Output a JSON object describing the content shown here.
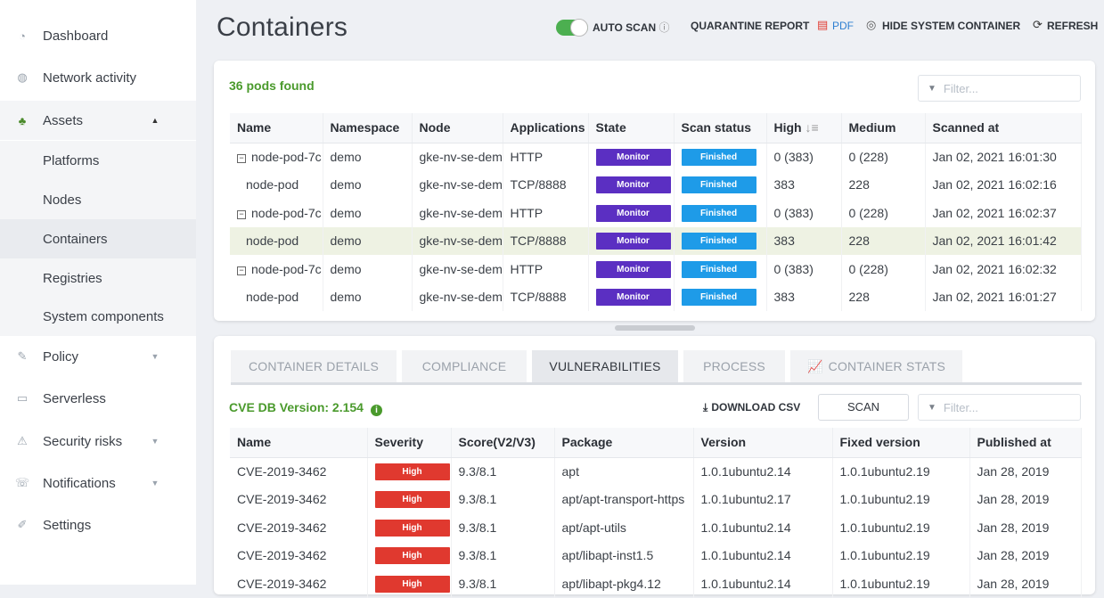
{
  "sidebar": {
    "items": [
      {
        "label": "Dashboard",
        "icon": "dashboard-icon"
      },
      {
        "label": "Network activity",
        "icon": "globe-icon"
      },
      {
        "label": "Assets",
        "icon": "assets-icon"
      },
      {
        "label": "Platforms"
      },
      {
        "label": "Nodes"
      },
      {
        "label": "Containers"
      },
      {
        "label": "Registries"
      },
      {
        "label": "System components"
      },
      {
        "label": "Policy",
        "icon": "policy-icon"
      },
      {
        "label": "Serverless",
        "icon": "serverless-icon"
      },
      {
        "label": "Security risks",
        "icon": "security-risks-icon"
      },
      {
        "label": "Notifications",
        "icon": "notifications-icon"
      },
      {
        "label": "Settings",
        "icon": "settings-icon"
      }
    ]
  },
  "header": {
    "title": "Containers",
    "auto_scan": "AUTO SCAN",
    "quarantine_report": "QUARANTINE REPORT",
    "pdf": "PDF",
    "hide_system": "HIDE SYSTEM CONTAINER",
    "refresh": "REFRESH"
  },
  "pods": {
    "count_text": "36 pods found",
    "filter_placeholder": "Filter...",
    "columns": [
      "Name",
      "Namespace",
      "Node",
      "Applications",
      "State",
      "Scan status",
      "High",
      "Medium",
      "Scanned at"
    ],
    "rows": [
      {
        "name": "node-pod-7c",
        "ns": "demo",
        "node": "gke-nv-se-dem",
        "app": "HTTP",
        "state": "Monitor",
        "scan": "Finished",
        "high": "0 (383)",
        "medium": "0 (228)",
        "at": "Jan 02, 2021 16:01:30",
        "expand": true
      },
      {
        "name": "node-pod",
        "ns": "demo",
        "node": "gke-nv-se-dem",
        "app": "TCP/8888",
        "state": "Monitor",
        "scan": "Finished",
        "high": "383",
        "medium": "228",
        "at": "Jan 02, 2021 16:02:16",
        "expand": false
      },
      {
        "name": "node-pod-7c",
        "ns": "demo",
        "node": "gke-nv-se-dem",
        "app": "HTTP",
        "state": "Monitor",
        "scan": "Finished",
        "high": "0 (383)",
        "medium": "0 (228)",
        "at": "Jan 02, 2021 16:02:37",
        "expand": true
      },
      {
        "name": "node-pod",
        "ns": "demo",
        "node": "gke-nv-se-dem",
        "app": "TCP/8888",
        "state": "Monitor",
        "scan": "Finished",
        "high": "383",
        "medium": "228",
        "at": "Jan 02, 2021 16:01:42",
        "expand": false
      },
      {
        "name": "node-pod-7c",
        "ns": "demo",
        "node": "gke-nv-se-dem",
        "app": "HTTP",
        "state": "Monitor",
        "scan": "Finished",
        "high": "0 (383)",
        "medium": "0 (228)",
        "at": "Jan 02, 2021 16:02:32",
        "expand": true
      },
      {
        "name": "node-pod",
        "ns": "demo",
        "node": "gke-nv-se-dem",
        "app": "TCP/8888",
        "state": "Monitor",
        "scan": "Finished",
        "high": "383",
        "medium": "228",
        "at": "Jan 02, 2021 16:01:27",
        "expand": false
      }
    ]
  },
  "tabs": [
    "CONTAINER DETAILS",
    "COMPLIANCE",
    "VULNERABILITIES",
    "PROCESS",
    "CONTAINER STATS"
  ],
  "vulns": {
    "db_version": "CVE DB Version:  2.154",
    "download_csv": "DOWNLOAD CSV",
    "scan": "SCAN",
    "filter_placeholder": "Filter...",
    "columns": [
      "Name",
      "Severity",
      "Score(V2/V3)",
      "Package",
      "Version",
      "Fixed version",
      "Published at"
    ],
    "rows": [
      {
        "name": "CVE-2019-3462",
        "sev": "High",
        "score": "9.3/8.1",
        "pkg": "apt",
        "ver": "1.0.1ubuntu2.14",
        "fixed": "1.0.1ubuntu2.19",
        "pub": "Jan 28, 2019"
      },
      {
        "name": "CVE-2019-3462",
        "sev": "High",
        "score": "9.3/8.1",
        "pkg": "apt/apt-transport-https",
        "ver": "1.0.1ubuntu2.17",
        "fixed": "1.0.1ubuntu2.19",
        "pub": "Jan 28, 2019"
      },
      {
        "name": "CVE-2019-3462",
        "sev": "High",
        "score": "9.3/8.1",
        "pkg": "apt/apt-utils",
        "ver": "1.0.1ubuntu2.14",
        "fixed": "1.0.1ubuntu2.19",
        "pub": "Jan 28, 2019"
      },
      {
        "name": "CVE-2019-3462",
        "sev": "High",
        "score": "9.3/8.1",
        "pkg": "apt/libapt-inst1.5",
        "ver": "1.0.1ubuntu2.14",
        "fixed": "1.0.1ubuntu2.19",
        "pub": "Jan 28, 2019"
      },
      {
        "name": "CVE-2019-3462",
        "sev": "High",
        "score": "9.3/8.1",
        "pkg": "apt/libapt-pkg4.12",
        "ver": "1.0.1ubuntu2.14",
        "fixed": "1.0.1ubuntu2.19",
        "pub": "Jan 28, 2019"
      }
    ]
  },
  "colors": {
    "accent_green": "#4a9a2c",
    "monitor": "#5b2fc2",
    "finished": "#1e9be8",
    "high": "#e0392f",
    "toggle_on": "#4caf50"
  }
}
